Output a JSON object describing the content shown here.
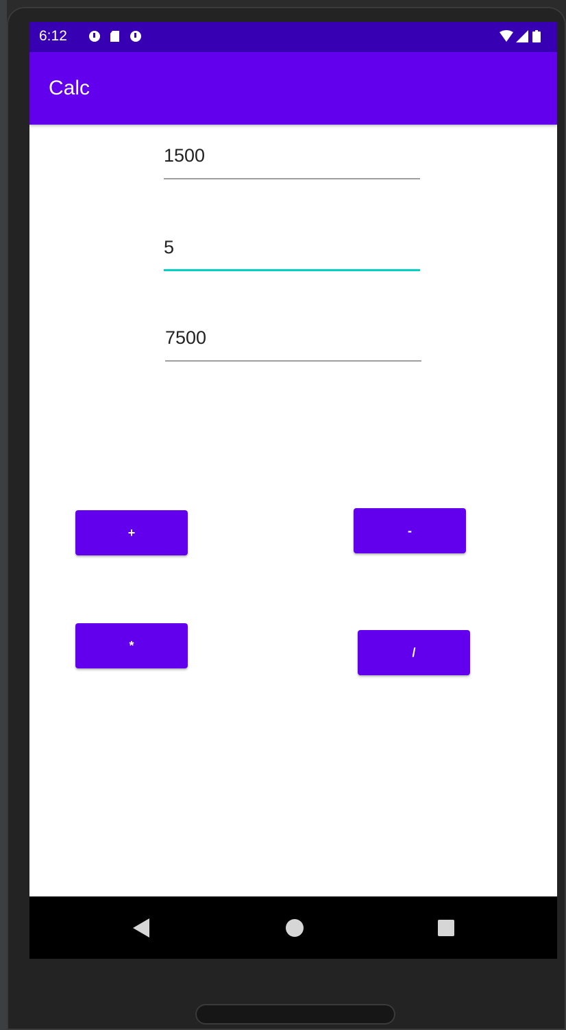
{
  "status_bar": {
    "time": "6:12",
    "left_icons": [
      "data-saver-icon",
      "sd-card-icon",
      "data-saver-icon"
    ],
    "right_icons": [
      "wifi-icon",
      "cell-signal-icon",
      "battery-icon"
    ]
  },
  "app_bar": {
    "title": "Calc"
  },
  "fields": {
    "first_number": "1500",
    "second_number": "5",
    "result": "7500"
  },
  "buttons": {
    "add": "+",
    "subtract": "-",
    "multiply": "*",
    "divide": "/"
  },
  "nav_bar": {
    "icons": [
      "back-icon",
      "home-icon",
      "recents-icon"
    ]
  },
  "colors": {
    "primary": "#6200ee",
    "primary_dark": "#3700b3",
    "accent": "#00d3c4"
  }
}
